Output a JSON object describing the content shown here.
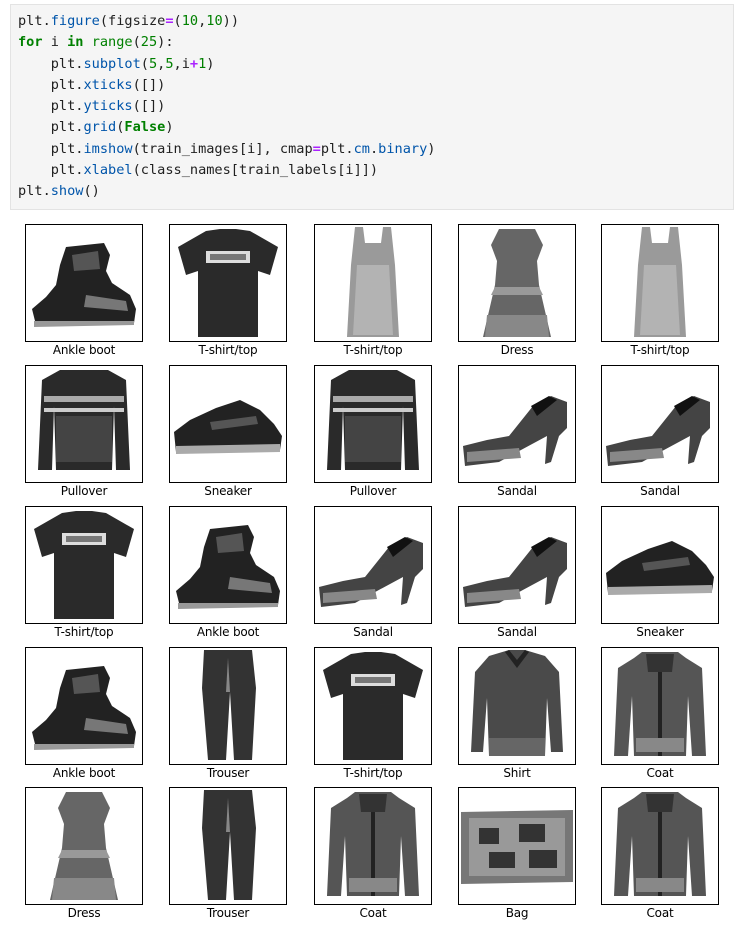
{
  "code": {
    "lines": [
      [
        [
          "n",
          "plt"
        ],
        [
          "p",
          "."
        ],
        [
          "f",
          "figure"
        ],
        [
          "p",
          "(figsize"
        ],
        [
          "o",
          "="
        ],
        [
          "p",
          "("
        ],
        [
          "num",
          "10"
        ],
        [
          "p",
          ","
        ],
        [
          "num",
          "10"
        ],
        [
          "p",
          "))"
        ]
      ],
      [
        [
          "k",
          "for"
        ],
        [
          "n",
          " i "
        ],
        [
          "k",
          "in"
        ],
        [
          "n",
          " "
        ],
        [
          "bi",
          "range"
        ],
        [
          "p",
          "("
        ],
        [
          "num",
          "25"
        ],
        [
          "p",
          "):"
        ]
      ],
      [
        [
          "n",
          "    plt"
        ],
        [
          "p",
          "."
        ],
        [
          "f",
          "subplot"
        ],
        [
          "p",
          "("
        ],
        [
          "num",
          "5"
        ],
        [
          "p",
          ","
        ],
        [
          "num",
          "5"
        ],
        [
          "p",
          ",i"
        ],
        [
          "o",
          "+"
        ],
        [
          "num",
          "1"
        ],
        [
          "p",
          ")"
        ]
      ],
      [
        [
          "n",
          "    plt"
        ],
        [
          "p",
          "."
        ],
        [
          "f",
          "xticks"
        ],
        [
          "p",
          "([])"
        ]
      ],
      [
        [
          "n",
          "    plt"
        ],
        [
          "p",
          "."
        ],
        [
          "f",
          "yticks"
        ],
        [
          "p",
          "([])"
        ]
      ],
      [
        [
          "n",
          "    plt"
        ],
        [
          "p",
          "."
        ],
        [
          "f",
          "grid"
        ],
        [
          "p",
          "("
        ],
        [
          "k",
          "False"
        ],
        [
          "p",
          ")"
        ]
      ],
      [
        [
          "n",
          "    plt"
        ],
        [
          "p",
          "."
        ],
        [
          "f",
          "imshow"
        ],
        [
          "p",
          "(train_images[i], cmap"
        ],
        [
          "o",
          "="
        ],
        [
          "p",
          "plt"
        ],
        [
          "p",
          "."
        ],
        [
          "f",
          "cm"
        ],
        [
          "p",
          "."
        ],
        [
          "f",
          "binary"
        ],
        [
          "p",
          ")"
        ]
      ],
      [
        [
          "n",
          "    plt"
        ],
        [
          "p",
          "."
        ],
        [
          "f",
          "xlabel"
        ],
        [
          "p",
          "(class_names[train_labels[i]])"
        ]
      ],
      [
        [
          "n",
          "plt"
        ],
        [
          "p",
          "."
        ],
        [
          "f",
          "show"
        ],
        [
          "p",
          "()"
        ]
      ]
    ]
  },
  "figure": {
    "labels": [
      "Ankle boot",
      "T-shirt/top",
      "T-shirt/top",
      "Dress",
      "T-shirt/top",
      "Pullover",
      "Sneaker",
      "Pullover",
      "Sandal",
      "Sandal",
      "T-shirt/top",
      "Ankle boot",
      "Sandal",
      "Sandal",
      "Sneaker",
      "Ankle boot",
      "Trouser",
      "T-shirt/top",
      "Shirt",
      "Coat",
      "Dress",
      "Trouser",
      "Coat",
      "Bag",
      "Coat"
    ],
    "icons": [
      "ankle-boot-icon",
      "tshirt-icon",
      "tank-top-icon",
      "dress-icon",
      "tank-top-icon",
      "pullover-icon",
      "sneaker-icon",
      "pullover-icon",
      "sandal-icon",
      "sandal-icon",
      "tshirt-icon",
      "ankle-boot-icon",
      "sandal-icon",
      "sandal-icon",
      "sneaker-icon",
      "ankle-boot-icon",
      "trouser-icon",
      "tshirt-icon",
      "shirt-icon",
      "coat-icon",
      "dress-icon",
      "trouser-icon",
      "coat-icon",
      "bag-icon",
      "coat-icon"
    ]
  }
}
